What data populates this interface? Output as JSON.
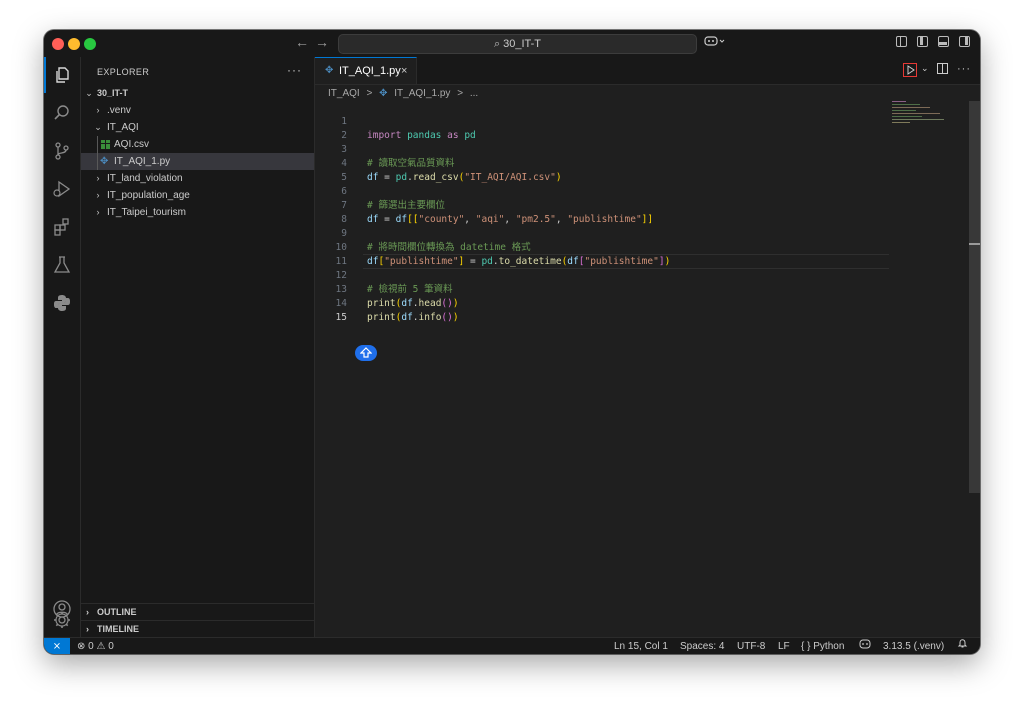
{
  "titlebar": {
    "search_text": "30_IT-T",
    "search_icon": "magnifier-icon",
    "back_icon": "arrow-left-icon",
    "forward_icon": "arrow-right-icon",
    "copilot_icon": "copilot-icon"
  },
  "activity_bar": {
    "items": [
      "explorer-icon",
      "search-icon",
      "source-control-icon",
      "run-debug-icon",
      "extensions-icon",
      "testing-icon",
      "python-icon"
    ],
    "bottom": [
      "account-icon",
      "gear-icon"
    ]
  },
  "sidebar": {
    "title": "EXPLORER",
    "more": "···",
    "root": "30_IT-T",
    "items": [
      {
        "label": ".venv",
        "type": "folder",
        "expanded": false
      },
      {
        "label": "IT_AQI",
        "type": "folder",
        "expanded": true
      },
      {
        "label": "AQI.csv",
        "type": "csv"
      },
      {
        "label": "IT_AQI_1.py",
        "type": "python",
        "selected": true
      },
      {
        "label": "IT_land_violation",
        "type": "folder",
        "expanded": false
      },
      {
        "label": "IT_population_age",
        "type": "folder",
        "expanded": false
      },
      {
        "label": "IT_Taipei_tourism",
        "type": "folder",
        "expanded": false
      }
    ],
    "outline": "OUTLINE",
    "timeline": "TIMELINE"
  },
  "editor": {
    "tab_label": "IT_AQI_1.py",
    "tab_close": "×",
    "breadcrumbs": [
      "IT_AQI",
      ">",
      "IT_AQI_1.py",
      ">",
      "..."
    ],
    "line_numbers": [
      "1",
      "2",
      "3",
      "4",
      "5",
      "6",
      "7",
      "8",
      "9",
      "10",
      "11",
      "12",
      "13",
      "14",
      "15"
    ],
    "current_line": 15,
    "code": {
      "l1": {
        "a": "import",
        "b": "pandas",
        "c": "as",
        "d": "pd"
      },
      "l3": "# 讀取空氣品質資料",
      "l4": {
        "a": "df",
        "b": " = ",
        "c": "pd",
        "d": ".",
        "e": "read_csv",
        "f": "(",
        "g": "\"IT_AQI/AQI.csv\"",
        "h": ")"
      },
      "l6": "# 篩選出主要欄位",
      "l7": {
        "a": "df",
        "b": " = ",
        "c": "df",
        "d": "[[",
        "e": "\"county\"",
        "f": ", ",
        "g": "\"aqi\"",
        "h": ", ",
        "i": "\"pm2.5\"",
        "j": ", ",
        "k": "\"publishtime\"",
        "l": "]]"
      },
      "l9": "# 將時間欄位轉換為 datetime 格式",
      "l10": {
        "a": "df",
        "b": "[",
        "c": "\"publishtime\"",
        "d": "]",
        "e": " = ",
        "f": "pd",
        "g": ".",
        "h": "to_datetime",
        "i": "(",
        "j": "df",
        "k": "[",
        "l": "\"publishtime\"",
        "m": "]",
        "n": ")"
      },
      "l12": "# 檢視前 5 筆資料",
      "l13": {
        "a": "print",
        "b": "(",
        "c": "df",
        "d": ".",
        "e": "head",
        "f": "()",
        "g": ")"
      },
      "l14": {
        "a": "print",
        "b": "(",
        "c": "df",
        "d": ".",
        "e": "info",
        "f": "()",
        "g": ")"
      }
    }
  },
  "statusbar": {
    "remote_icon": "remote-icon",
    "errors": "0",
    "warnings": "0",
    "position": "Ln 15, Col 1",
    "spaces": "Spaces: 4",
    "encoding": "UTF-8",
    "eol": "LF",
    "language": "Python",
    "language_prefix": "{ }",
    "interpreter": "3.13.5 (.venv)",
    "bell_icon": "bell-icon"
  },
  "colors": {
    "accent": "#0078d4",
    "editor_bg": "#1f1f1f",
    "sidebar_bg": "#181818",
    "run_highlight": "#e53935"
  }
}
